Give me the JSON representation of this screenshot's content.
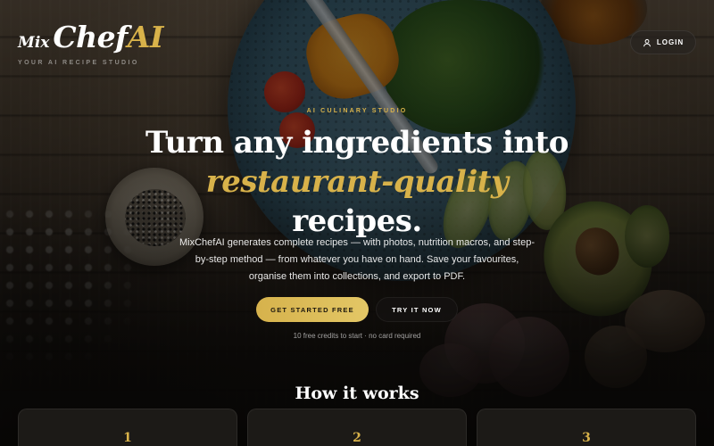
{
  "brand": {
    "logo_prefix": "Mix",
    "logo_main": "Chef",
    "logo_accent": "AI",
    "tagline": "YOUR AI RECIPE STUDIO",
    "accent_color": "#d8b24a"
  },
  "header": {
    "login_label": "LOGIN",
    "login_icon": "user-icon"
  },
  "hero": {
    "eyebrow": "AI CULINARY STUDIO",
    "headline_line1": "Turn any ingredients into",
    "headline_accent": "restaurant-quality",
    "headline_line3": "recipes.",
    "description": "MixChefAI generates complete recipes — with photos, nutrition macros, and step-by-step method — from whatever you have on hand. Save your favourites, organise them into collections, and export to PDF.",
    "primary_cta": "GET STARTED FREE",
    "secondary_cta": "TRY IT NOW",
    "note": "10 free credits to start · no card required"
  },
  "how_it_works": {
    "title": "How it works",
    "steps": [
      {
        "number": "1"
      },
      {
        "number": "2"
      },
      {
        "number": "3"
      }
    ]
  }
}
